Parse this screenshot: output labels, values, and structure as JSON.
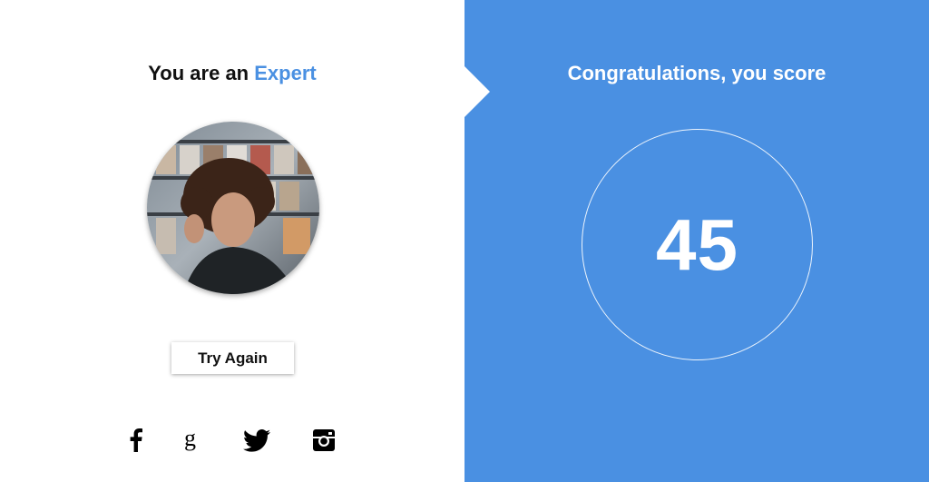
{
  "result": {
    "prefix": "You are an",
    "level": "Expert",
    "avatar_alt": "avatar-photo",
    "try_again_label": "Try Again"
  },
  "social": {
    "icons": [
      "facebook-icon",
      "google-icon",
      "twitter-icon",
      "instagram-icon"
    ]
  },
  "score": {
    "heading": "Congratulations, you score",
    "value": "45"
  },
  "colors": {
    "accent": "#4a90e2",
    "panel": "#4a90e2",
    "text": "#111111"
  }
}
